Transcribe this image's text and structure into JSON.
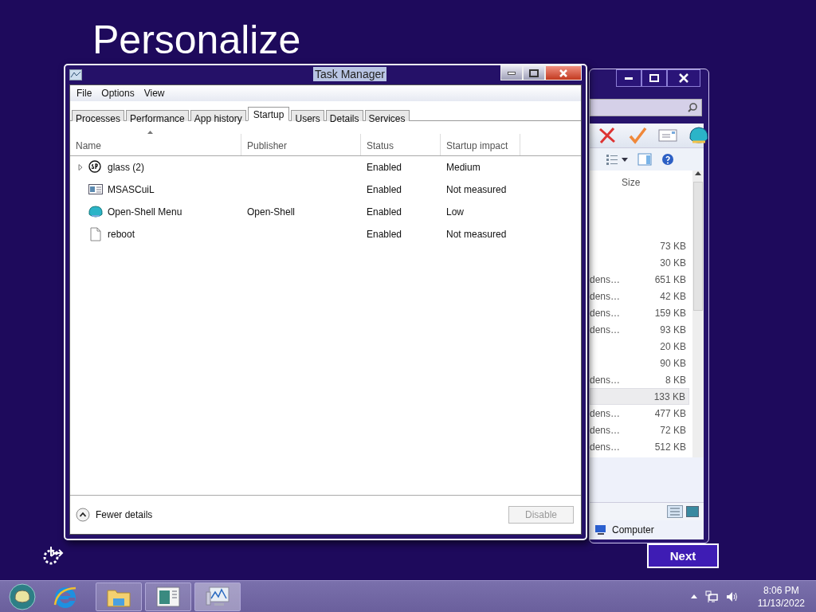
{
  "desktop": {
    "heading": "Personalize",
    "next_button": "Next"
  },
  "explorer": {
    "columns": [
      "Size"
    ],
    "rows": [
      {
        "type": "",
        "size": "73 KB",
        "selected": false
      },
      {
        "type": "",
        "size": "30 KB",
        "selected": false
      },
      {
        "type": "dens…",
        "size": "651 KB",
        "selected": false
      },
      {
        "type": "dens…",
        "size": "42 KB",
        "selected": false
      },
      {
        "type": "dens…",
        "size": "159 KB",
        "selected": false
      },
      {
        "type": "dens…",
        "size": "93 KB",
        "selected": false
      },
      {
        "type": "",
        "size": "20 KB",
        "selected": false
      },
      {
        "type": "",
        "size": "90 KB",
        "selected": false
      },
      {
        "type": "dens…",
        "size": "8 KB",
        "selected": false
      },
      {
        "type": "",
        "size": "133 KB",
        "selected": true
      },
      {
        "type": "dens…",
        "size": "477 KB",
        "selected": false
      },
      {
        "type": "dens…",
        "size": "72 KB",
        "selected": false
      },
      {
        "type": "dens…",
        "size": "512 KB",
        "selected": false
      }
    ],
    "status": "Computer"
  },
  "task_manager": {
    "title": "Task Manager",
    "menu": [
      "File",
      "Options",
      "View"
    ],
    "tabs": [
      {
        "label": "Processes",
        "selected": false
      },
      {
        "label": "Performance",
        "selected": false
      },
      {
        "label": "App history",
        "selected": false
      },
      {
        "label": "Startup",
        "selected": true
      },
      {
        "label": "Users",
        "selected": false
      },
      {
        "label": "Details",
        "selected": false
      },
      {
        "label": "Services",
        "selected": false
      }
    ],
    "columns": [
      {
        "label": "Name",
        "sorted": true
      },
      {
        "label": "Publisher",
        "sorted": false
      },
      {
        "label": "Status",
        "sorted": false
      },
      {
        "label": "Startup impact",
        "sorted": false
      }
    ],
    "rows": [
      {
        "kind": "sp",
        "expandable": true,
        "name": "glass (2)",
        "publisher": "",
        "status": "Enabled",
        "impact": "Medium"
      },
      {
        "kind": "window",
        "expandable": false,
        "name": "MSASCuiL",
        "publisher": "",
        "status": "Enabled",
        "impact": "Not measured"
      },
      {
        "kind": "shell",
        "expandable": false,
        "name": "Open-Shell Menu",
        "publisher": "Open-Shell",
        "status": "Enabled",
        "impact": "Low"
      },
      {
        "kind": "file",
        "expandable": false,
        "name": "reboot",
        "publisher": "",
        "status": "Enabled",
        "impact": "Not measured"
      }
    ],
    "details_toggle": "Fewer details",
    "disable_button": {
      "label": "Disable",
      "disabled": true
    }
  },
  "taskbar": {
    "items": [
      {
        "kind": "folder",
        "selected": false
      },
      {
        "kind": "app",
        "selected": false
      },
      {
        "kind": "monitor",
        "selected": true
      }
    ],
    "time": "8:06 PM",
    "date": "11/13/2022"
  }
}
